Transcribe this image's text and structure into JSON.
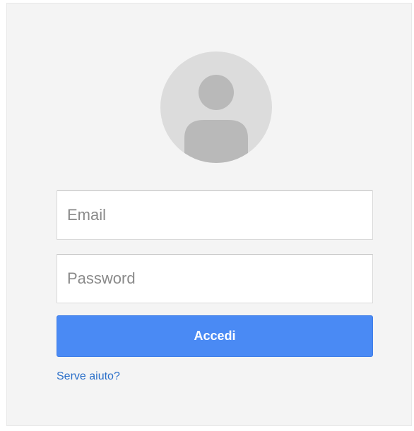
{
  "login": {
    "avatar_icon": "user-avatar-icon",
    "email_placeholder": "Email",
    "email_value": "",
    "password_placeholder": "Password",
    "password_value": "",
    "signin_label": "Accedi",
    "help_link": "Serve aiuto?"
  },
  "colors": {
    "background": "#f4f4f4",
    "avatar_bg": "#dcdcdc",
    "avatar_figure": "#b9b9b9",
    "button": "#4a8af4",
    "link": "#2b6fc9"
  }
}
